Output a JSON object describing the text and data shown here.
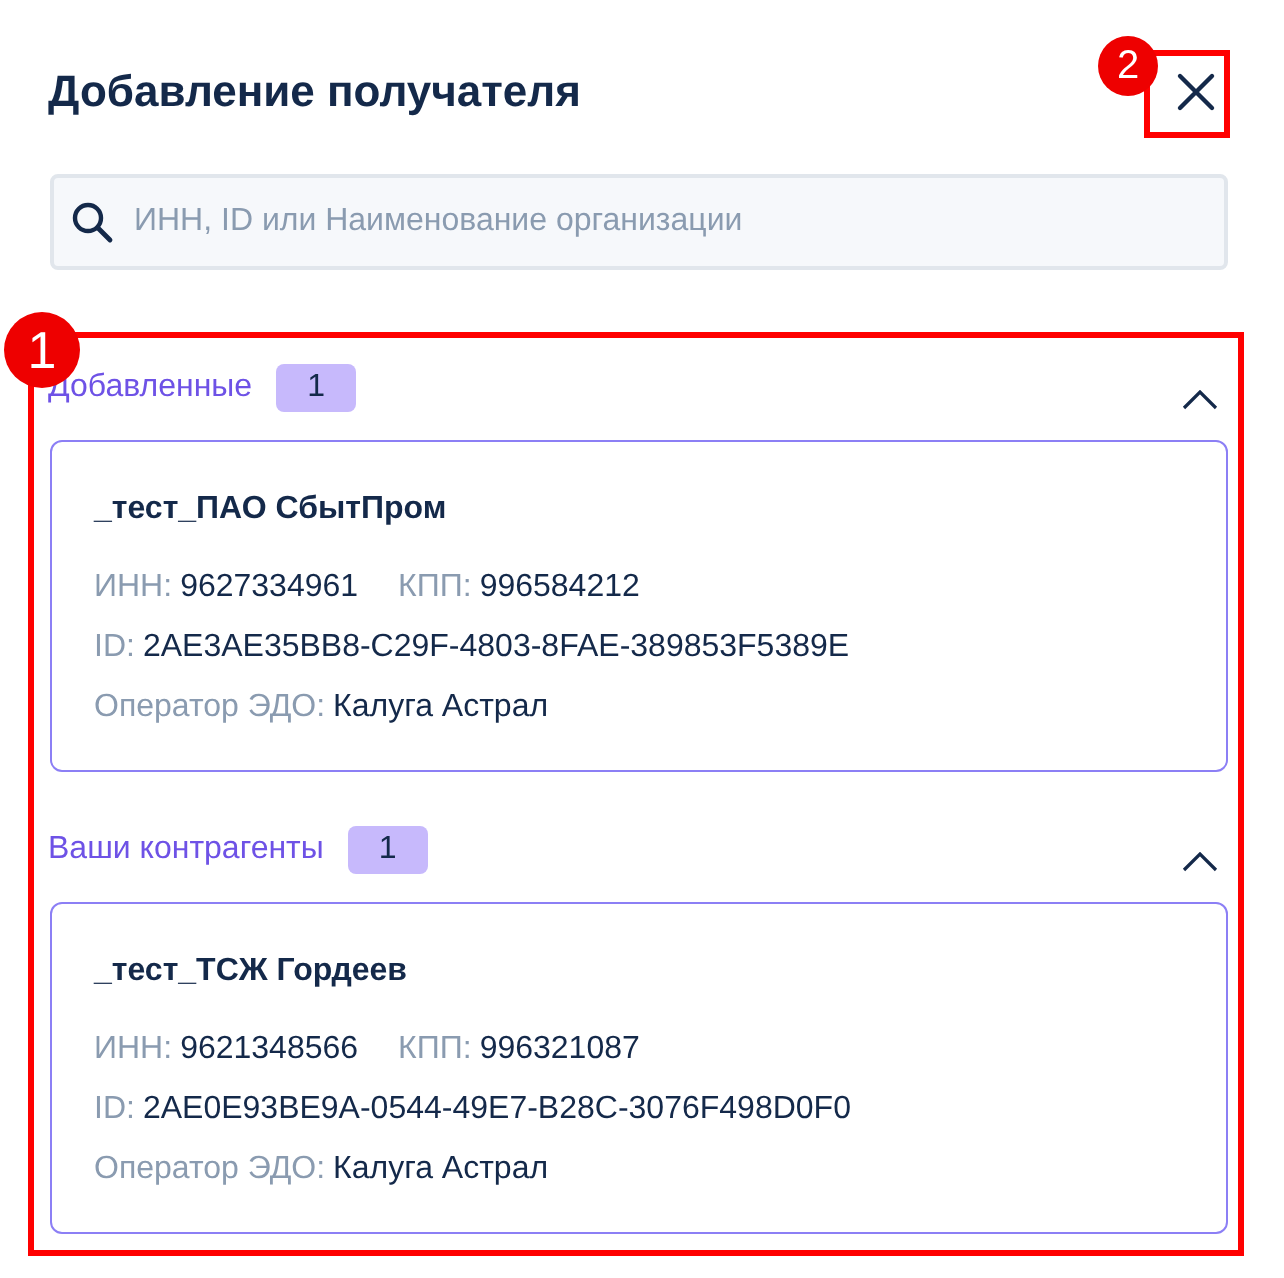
{
  "dialog": {
    "title": "Добавление получателя",
    "search": {
      "placeholder": "ИНН, ID или Наименование организации"
    },
    "sections": [
      {
        "title": "Добавленные",
        "count": "1",
        "expanded": true,
        "cards": [
          {
            "name": "_тест_ПАО СбытПром",
            "inn_label": "ИНН:",
            "inn": "9627334961",
            "kpp_label": "КПП:",
            "kpp": "996584212",
            "id_label": "ID:",
            "id": "2AE3AE35BB8-C29F-4803-8FAE-389853F5389E",
            "operator_label": "Оператор ЭДО:",
            "operator": "Калуга Астрал"
          }
        ]
      },
      {
        "title": "Ваши контрагенты",
        "count": "1",
        "expanded": true,
        "cards": [
          {
            "name": "_тест_ТСЖ Гордеев",
            "inn_label": "ИНН:",
            "inn": "9621348566",
            "kpp_label": "КПП:",
            "kpp": "996321087",
            "id_label": "ID:",
            "id": "2AE0E93BE9A-0544-49E7-B28C-3076F498D0F0",
            "operator_label": "Оператор ЭДО:",
            "operator": "Калуга Астрал"
          }
        ]
      }
    ]
  },
  "annotations": [
    {
      "label": "1"
    },
    {
      "label": "2"
    }
  ]
}
